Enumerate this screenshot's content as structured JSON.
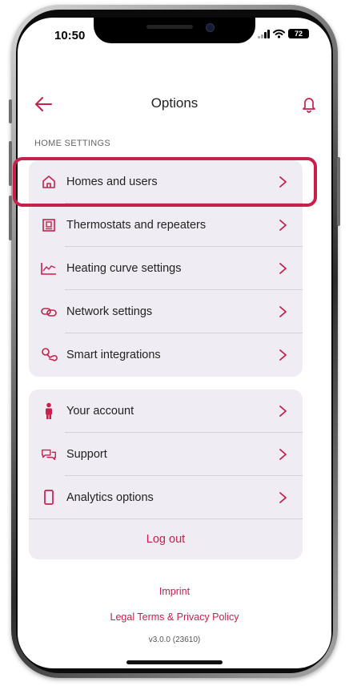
{
  "status_bar": {
    "time": "10:50",
    "battery": "72"
  },
  "header": {
    "title": "Options"
  },
  "home_settings": {
    "section_label": "HOME SETTINGS",
    "items": [
      {
        "label": "Homes and users",
        "icon": "house-icon"
      },
      {
        "label": "Thermostats and repeaters",
        "icon": "thermostat-icon"
      },
      {
        "label": "Heating curve settings",
        "icon": "chart-line-icon"
      },
      {
        "label": "Network settings",
        "icon": "link-icon"
      },
      {
        "label": "Smart integrations",
        "icon": "integration-icon"
      }
    ]
  },
  "account_settings": {
    "items": [
      {
        "label": "Your account",
        "icon": "person-icon"
      },
      {
        "label": "Support",
        "icon": "chat-bubbles-icon"
      },
      {
        "label": "Analytics options",
        "icon": "phone-icon"
      }
    ],
    "logout_label": "Log out"
  },
  "footer": {
    "imprint": "Imprint",
    "legal": "Legal Terms & Privacy Policy",
    "version": "v3.0.0 (23610)"
  },
  "colors": {
    "accent": "#c8204a",
    "card_bg": "#efedf3",
    "text": "#222222"
  }
}
